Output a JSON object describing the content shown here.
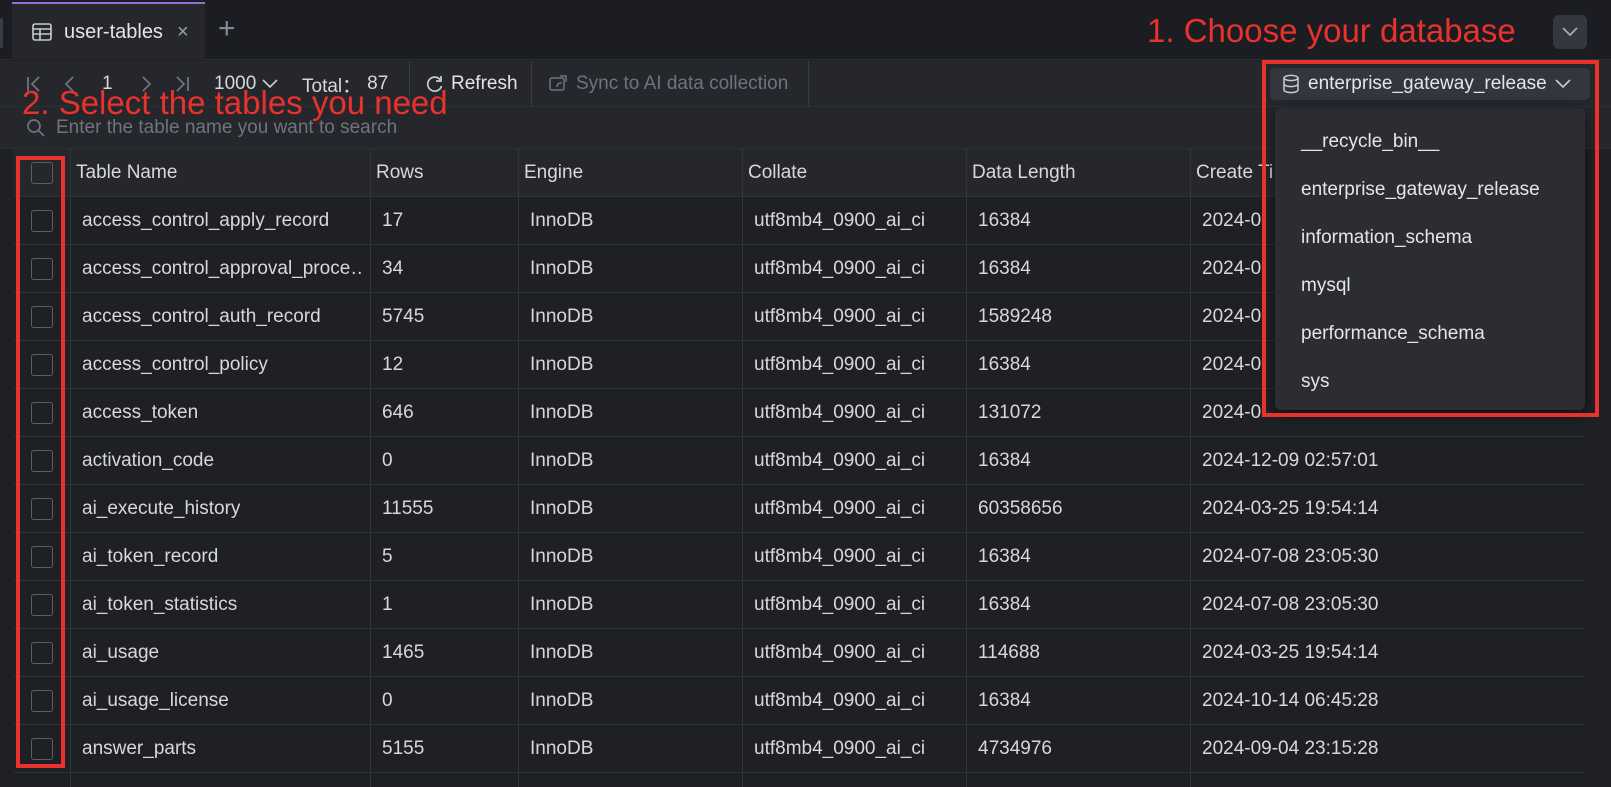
{
  "tab": {
    "label": "user-tables",
    "close": "×",
    "add": "+"
  },
  "toolbar": {
    "page": "1",
    "page_size": "1000",
    "total_label": "Total：",
    "total_value": "87",
    "refresh_label": "Refresh",
    "sync_label": "Sync to AI data collection",
    "database": "enterprise_gateway_release"
  },
  "search": {
    "placeholder": "Enter the table name you want to search"
  },
  "table": {
    "headers": [
      "Table Name",
      "Rows",
      "Engine",
      "Collate",
      "Data Length",
      "Create Ti"
    ],
    "rows": [
      [
        "access_control_apply_record",
        "17",
        "InnoDB",
        "utf8mb4_0900_ai_ci",
        "16384",
        "2024-0"
      ],
      [
        "access_control_approval_proce…",
        "34",
        "InnoDB",
        "utf8mb4_0900_ai_ci",
        "16384",
        "2024-0"
      ],
      [
        "access_control_auth_record",
        "5745",
        "InnoDB",
        "utf8mb4_0900_ai_ci",
        "1589248",
        "2024-0"
      ],
      [
        "access_control_policy",
        "12",
        "InnoDB",
        "utf8mb4_0900_ai_ci",
        "16384",
        "2024-0"
      ],
      [
        "access_token",
        "646",
        "InnoDB",
        "utf8mb4_0900_ai_ci",
        "131072",
        "2024-0"
      ],
      [
        "activation_code",
        "0",
        "InnoDB",
        "utf8mb4_0900_ai_ci",
        "16384",
        "2024-12-09 02:57:01"
      ],
      [
        "ai_execute_history",
        "11555",
        "InnoDB",
        "utf8mb4_0900_ai_ci",
        "60358656",
        "2024-03-25 19:54:14"
      ],
      [
        "ai_token_record",
        "5",
        "InnoDB",
        "utf8mb4_0900_ai_ci",
        "16384",
        "2024-07-08 23:05:30"
      ],
      [
        "ai_token_statistics",
        "1",
        "InnoDB",
        "utf8mb4_0900_ai_ci",
        "16384",
        "2024-07-08 23:05:30"
      ],
      [
        "ai_usage",
        "1465",
        "InnoDB",
        "utf8mb4_0900_ai_ci",
        "114688",
        "2024-03-25 19:54:14"
      ],
      [
        "ai_usage_license",
        "0",
        "InnoDB",
        "utf8mb4_0900_ai_ci",
        "16384",
        "2024-10-14 06:45:28"
      ],
      [
        "answer_parts",
        "5155",
        "InnoDB",
        "utf8mb4_0900_ai_ci",
        "4734976",
        "2024-09-04 23:15:28"
      ]
    ]
  },
  "dropdown": {
    "options": [
      "__recycle_bin__",
      "enterprise_gateway_release",
      "information_schema",
      "mysql",
      "performance_schema",
      "sys"
    ]
  },
  "annotations": {
    "step1": "1. Choose your database",
    "step2": "2. Select the tables you need",
    "color": "#e8322b"
  },
  "icons": [
    "table-icon",
    "close-icon",
    "plus-icon",
    "chevron-down-icon",
    "first-page-icon",
    "prev-page-icon",
    "next-page-icon",
    "last-page-icon",
    "refresh-icon",
    "sync-icon",
    "database-icon",
    "search-icon"
  ]
}
